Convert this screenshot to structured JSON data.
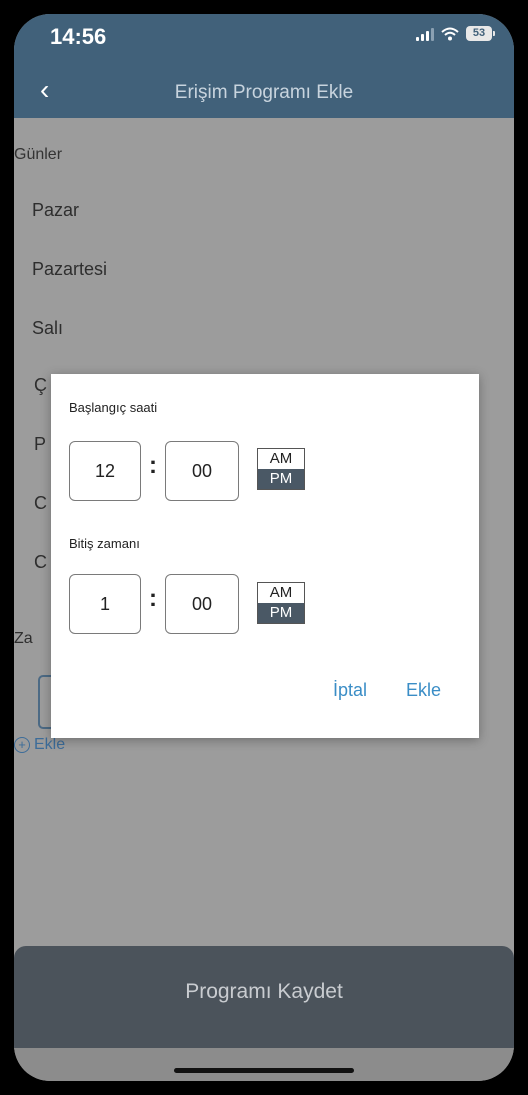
{
  "status_bar": {
    "time": "14:56",
    "battery": "53"
  },
  "header": {
    "title": "Erişim Programı Ekle"
  },
  "days_section": {
    "label": "Günler",
    "days": [
      "Pazar",
      "Pazartesi",
      "Salı"
    ],
    "partial_letters": [
      "Ç",
      "P",
      "C",
      "C"
    ],
    "zaman_fragment": "Za",
    "add_link": "Ekle"
  },
  "dialog": {
    "start_label": "Başlangıç saati",
    "start_hour": "12",
    "start_minute": "00",
    "end_label": "Bitiş zamanı",
    "end_hour": "1",
    "end_minute": "00",
    "colon": ":",
    "am_label": "AM",
    "pm_label": "PM",
    "cancel_label": "İptal",
    "confirm_label": "Ekle"
  },
  "footer": {
    "save_label": "Programı Kaydet"
  }
}
